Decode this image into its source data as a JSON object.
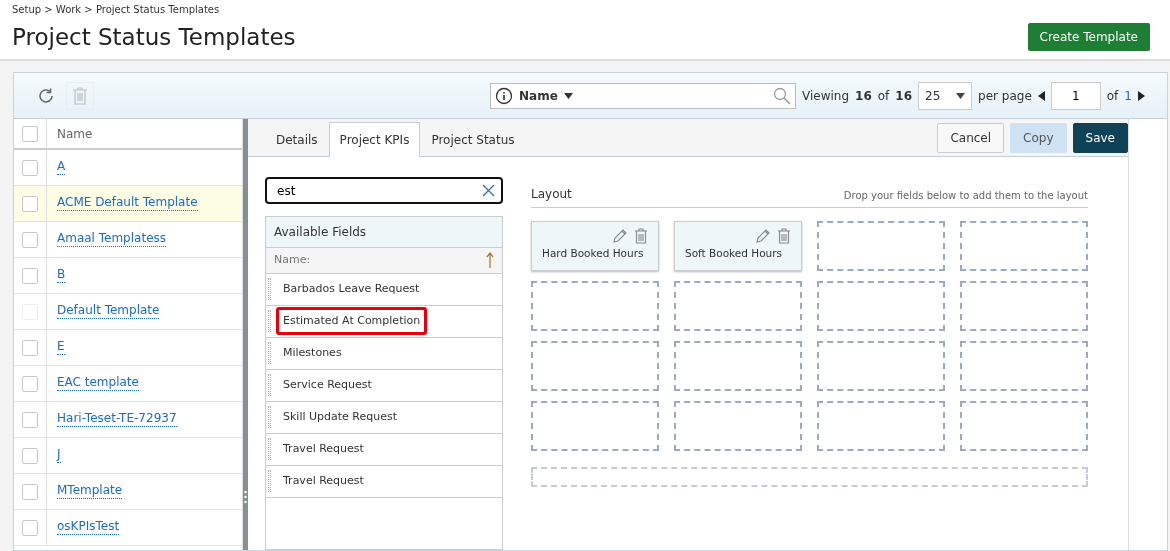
{
  "breadcrumb": "Setup > Work > Project Status Templates",
  "title": "Project Status Templates",
  "create_button": "Create Template",
  "toolbar": {
    "delete_disabled": true,
    "search_filter": "Name",
    "viewing_label": "Viewing",
    "viewing_range": "16",
    "viewing_of": "of",
    "viewing_total": "16",
    "page_size": "25",
    "per_page": "per page",
    "page": "1",
    "of_label": "of",
    "page_count": "1"
  },
  "templates": {
    "select_all_checked": false,
    "columns": [
      "Name"
    ],
    "rows": [
      {
        "name": "A",
        "selected": false,
        "disabled": false
      },
      {
        "name": "ACME Default Template",
        "selected": true,
        "disabled": false
      },
      {
        "name": "Amaal Templatess",
        "selected": false,
        "disabled": false
      },
      {
        "name": "B",
        "selected": false,
        "disabled": false
      },
      {
        "name": "Default Template",
        "selected": false,
        "disabled": true
      },
      {
        "name": "E",
        "selected": false,
        "disabled": false
      },
      {
        "name": "EAC template",
        "selected": false,
        "disabled": false
      },
      {
        "name": "Hari-Teset-TE-72937",
        "selected": false,
        "disabled": false
      },
      {
        "name": "J",
        "selected": false,
        "disabled": false
      },
      {
        "name": "MTemplate",
        "selected": false,
        "disabled": false
      },
      {
        "name": "osKPIsTest",
        "selected": false,
        "disabled": false
      }
    ]
  },
  "tabs": [
    {
      "label": "Details",
      "selected": false
    },
    {
      "label": "Project KPIs",
      "selected": true
    },
    {
      "label": "Project Status",
      "selected": false
    }
  ],
  "actions": [
    {
      "label": "Cancel",
      "kind": "default"
    },
    {
      "label": "Copy",
      "kind": "light"
    },
    {
      "label": "Save",
      "kind": "primary"
    }
  ],
  "field_search": {
    "value": "est"
  },
  "available_fields": {
    "title": "Available Fields",
    "column": "Name:",
    "items": [
      {
        "label": "Barbados Leave Request",
        "highlighted": false
      },
      {
        "label": "Estimated At Completion",
        "highlighted": true
      },
      {
        "label": "Milestones",
        "highlighted": false
      },
      {
        "label": "Service Request",
        "highlighted": false
      },
      {
        "label": "Skill Update Request",
        "highlighted": false
      },
      {
        "label": "Travel Request",
        "highlighted": false
      },
      {
        "label": "Travel Request",
        "highlighted": false
      }
    ]
  },
  "layout": {
    "title": "Layout",
    "hint": "Drop your fields below to add them to the layout",
    "slots": [
      {
        "kind": "field",
        "label": "Hard Booked Hours"
      },
      {
        "kind": "field",
        "label": "Soft Booked Hours"
      },
      {
        "kind": "empty"
      },
      {
        "kind": "empty"
      },
      {
        "kind": "empty"
      },
      {
        "kind": "empty"
      },
      {
        "kind": "empty"
      },
      {
        "kind": "empty"
      },
      {
        "kind": "empty"
      },
      {
        "kind": "empty"
      },
      {
        "kind": "empty"
      },
      {
        "kind": "empty"
      },
      {
        "kind": "empty"
      },
      {
        "kind": "empty"
      },
      {
        "kind": "empty"
      },
      {
        "kind": "empty"
      },
      {
        "kind": "wide"
      }
    ]
  }
}
